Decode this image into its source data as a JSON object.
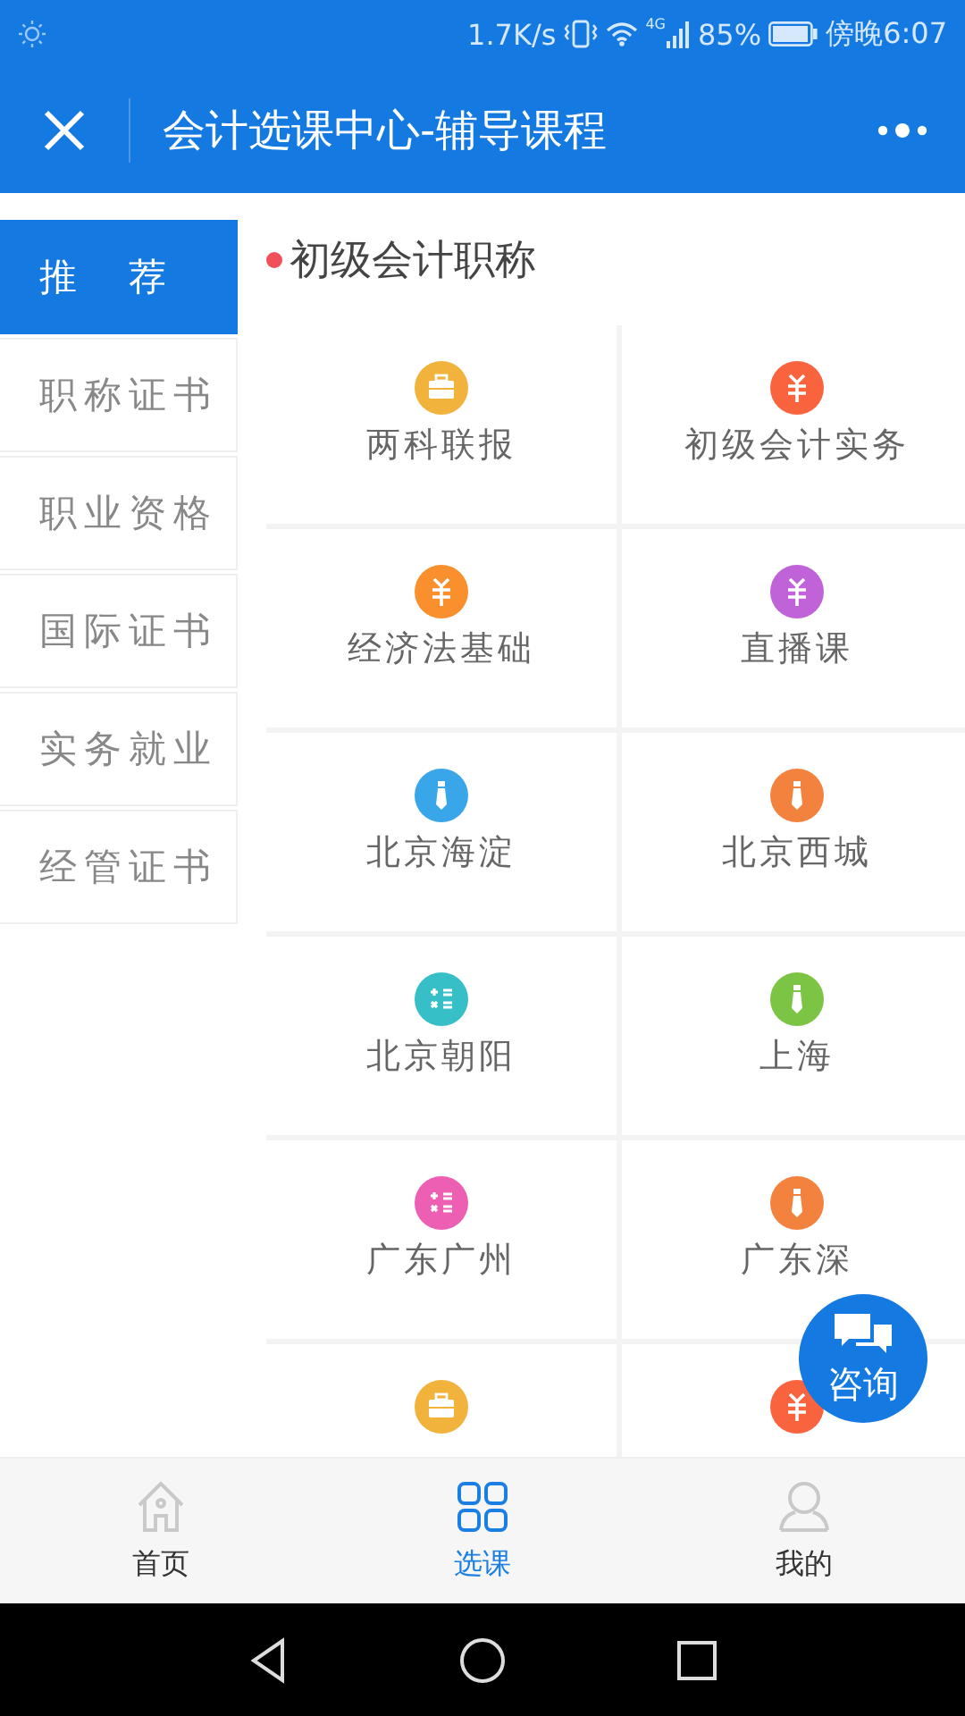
{
  "status_bar": {
    "speed": "1.7K/s",
    "network": "4G",
    "battery": "85%",
    "time": "傍晚6:07"
  },
  "header": {
    "title": "会计选课中心-辅导课程"
  },
  "sidebar": {
    "items": [
      {
        "label": "推　荐",
        "selected": true
      },
      {
        "label": "职称证书",
        "selected": false
      },
      {
        "label": "职业资格",
        "selected": false
      },
      {
        "label": "国际证书",
        "selected": false
      },
      {
        "label": "实务就业",
        "selected": false
      },
      {
        "label": "经管证书",
        "selected": false
      }
    ]
  },
  "section": {
    "title": "初级会计职称"
  },
  "courses": [
    {
      "label": "两科联报",
      "kind": "briefcase",
      "color": "#f2b33d"
    },
    {
      "label": "初级会计实务",
      "kind": "yuan",
      "color": "#f9643f"
    },
    {
      "label": "经济法基础",
      "kind": "yuan",
      "color": "#f98f2d"
    },
    {
      "label": "直播课",
      "kind": "yuan",
      "color": "#c062d8"
    },
    {
      "label": "北京海淀",
      "kind": "tie",
      "color": "#3aa6ea"
    },
    {
      "label": "北京西城",
      "kind": "tie",
      "color": "#f4823f"
    },
    {
      "label": "北京朝阳",
      "kind": "calc",
      "color": "#36bfc6"
    },
    {
      "label": "上海",
      "kind": "tie",
      "color": "#7cc443"
    },
    {
      "label": "广东广州",
      "kind": "calc",
      "color": "#ec5fb2"
    },
    {
      "label": "广东深",
      "kind": "tie",
      "color": "#f4823f"
    },
    {
      "kind": "briefcase",
      "color": "#f2b33d"
    },
    {
      "kind": "yuan",
      "color": "#f9643f"
    }
  ],
  "consult_button": {
    "label": "咨询"
  },
  "tab_bar": [
    {
      "label": "首页",
      "kind": "home",
      "selected": false
    },
    {
      "label": "选课",
      "kind": "grid",
      "selected": true
    },
    {
      "label": "我的",
      "kind": "user",
      "selected": false
    }
  ]
}
